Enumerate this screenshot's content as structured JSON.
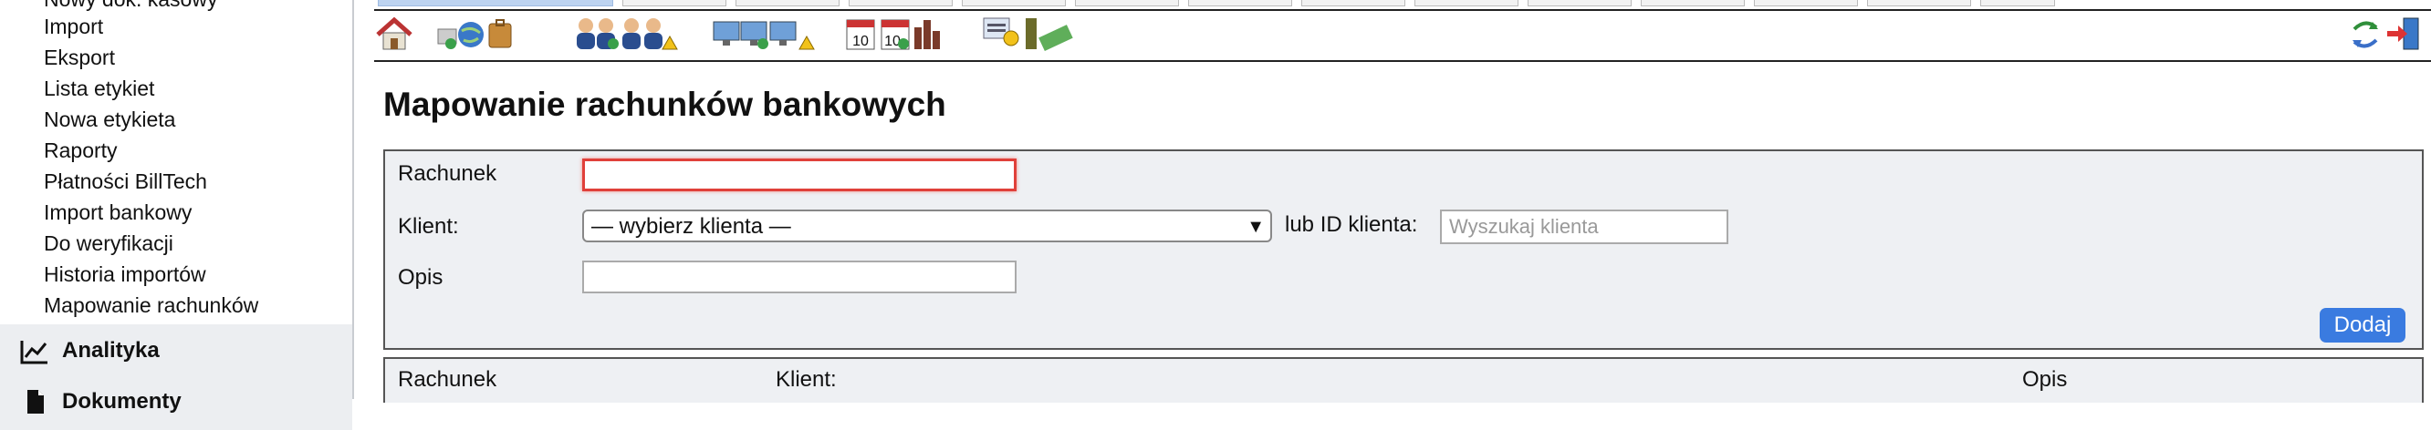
{
  "sidebar": {
    "items": [
      {
        "label": "Nowy dok. kasowy"
      },
      {
        "label": "Import"
      },
      {
        "label": "Eksport"
      },
      {
        "label": "Lista etykiet"
      },
      {
        "label": "Nowa etykieta"
      },
      {
        "label": "Raporty"
      },
      {
        "label": "Płatności BillTech"
      },
      {
        "label": "Import bankowy"
      },
      {
        "label": "Do weryfikacji"
      },
      {
        "label": "Historia importów"
      },
      {
        "label": "Mapowanie rachunków"
      }
    ],
    "sections": [
      {
        "label": "Analityka",
        "icon": "line-chart-icon"
      },
      {
        "label": "Dokumenty",
        "icon": "document-icon"
      }
    ]
  },
  "toolbar": {
    "icons": [
      "home-icon",
      "network-globe-icon",
      "users-icon",
      "computers-icon",
      "calendar-icon",
      "finance-money-icon",
      "refresh-arrows-icon",
      "logout-icon"
    ]
  },
  "page": {
    "title": "Mapowanie rachunków bankowych"
  },
  "form": {
    "account_label": "Rachunek",
    "account_value": "",
    "client_label": "Klient:",
    "client_selected": "— wybierz klienta —",
    "client_id_label": "lub ID klienta:",
    "client_search_placeholder": "Wyszukaj klienta",
    "description_label": "Opis",
    "description_value": "",
    "add_label": "Dodaj"
  },
  "table": {
    "columns": [
      "Rachunek",
      "Klient:",
      "Opis"
    ]
  },
  "colors": {
    "accent": "#3a7be0",
    "focus_border": "#e0403a",
    "panel_bg": "#eef0f3"
  }
}
